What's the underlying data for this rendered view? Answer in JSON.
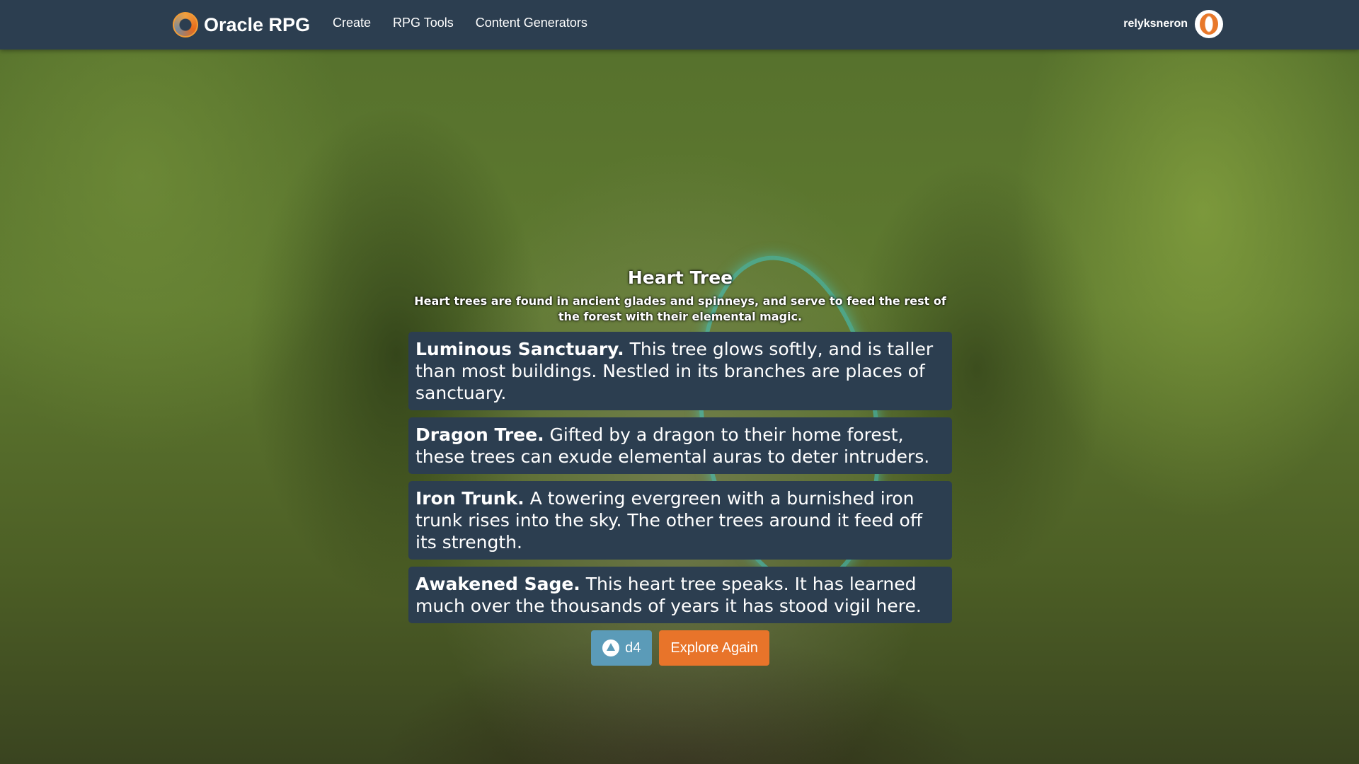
{
  "nav": {
    "brand": "Oracle RPG",
    "links": [
      "Create",
      "RPG Tools",
      "Content Generators"
    ],
    "username": "relyksneron"
  },
  "main": {
    "title": "Heart Tree",
    "description": "Heart trees are found in ancient glades and spinneys, and serve to feed the rest of the forest with their elemental magic.",
    "entries": [
      {
        "name": "Luminous Sanctuary.",
        "text": "This tree glows softly, and is taller than most buildings. Nestled in its branches are places of sanctuary."
      },
      {
        "name": "Dragon Tree.",
        "text": "Gifted by a dragon to their home forest, these trees can exude elemental auras to deter intruders."
      },
      {
        "name": "Iron Trunk.",
        "text": "A towering evergreen with a burnished iron trunk rises into the sky. The other trees around it feed off its strength."
      },
      {
        "name": "Awakened Sage.",
        "text": "This heart tree speaks. It has learned much over the thousands of years it has stood vigil here."
      }
    ],
    "dice_label": "d4",
    "explore_label": "Explore Again"
  },
  "icons": {
    "logo": "oracle-logo-icon",
    "avatar": "user-avatar-icon",
    "dice": "d20-icon"
  },
  "colors": {
    "navbar": "#2c3e50",
    "card": "#2c3e50",
    "dice_button": "#5b9bb8",
    "explore_button": "#e8742a"
  }
}
